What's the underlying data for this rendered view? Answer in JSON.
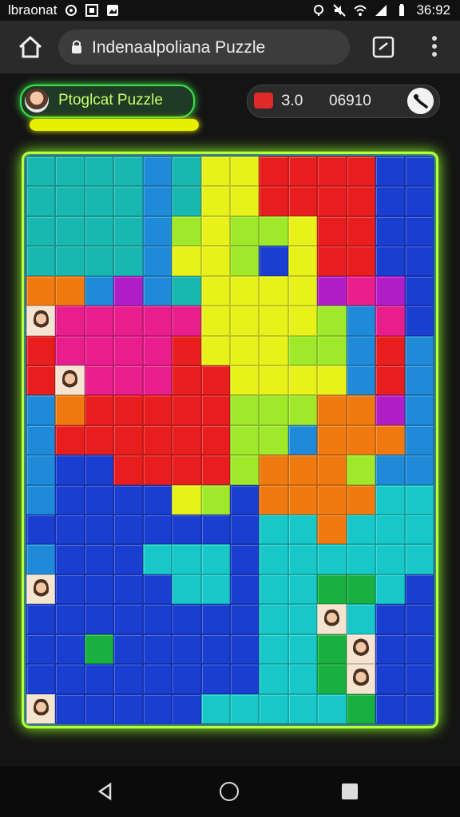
{
  "status_bar": {
    "carrier": "lbraonat",
    "time": "36:92",
    "icons_left": [
      "circle-icon",
      "photo-icon",
      "image-icon"
    ],
    "icons_right": [
      "location-icon",
      "mute-icon",
      "wifi-icon",
      "signal-icon",
      "battery-icon"
    ]
  },
  "browser": {
    "url_title": "Indenaalpoliana Puzzle",
    "icons": [
      "home-icon",
      "lock-icon",
      "tab-switch-icon",
      "more-vert-icon"
    ]
  },
  "game": {
    "player_name": "Ptoglcat Puzzle",
    "progress": 1.0,
    "score_a": "З.0",
    "score_b": "06910",
    "accent_color": "#b6ff3c"
  },
  "board": {
    "columns": 14,
    "rows": 19,
    "palette": {
      "T": "#18b8b0",
      "Y": "#e8f21a",
      "L": "#9fe82a",
      "R": "#e81e1e",
      "M": "#e81e8c",
      "P": "#b01ec8",
      "O": "#f07a10",
      "B": "#1a3ed0",
      "S": "#1e8ad8",
      "C": "#18c8c8",
      "G": "#18b040",
      "F": "face"
    },
    "grid": [
      "TTTTSTYYRRRRBB",
      "TTTTSTYYRRRRBB",
      "TTTTSLYLLYRRBB",
      "TTTTSYYLBYRRBB",
      "OOSPSTYYYYPMPB",
      "FMMMMMYYYYLSMB",
      "RMMMMRYYYLLSRS",
      "RFMMMRRYYYYSRS",
      "SORRRRRLLLOOPS",
      "SRRRRRRLLSOOOS",
      "SBBRRRRLOOOLSS",
      "SBBBBYLBOOOOCC",
      "BBBBBBBBCCOCCC",
      "SBBBCCCBCCCCCC",
      "FBBBBCCBCCGGCB",
      "BBBBBBBBCCFCBB",
      "BBGBBBBBCCGFBB",
      "BBBBBBBBCCGFBB",
      "FBBBBBCCCCCGBB"
    ]
  },
  "nav_bar": {
    "icons": [
      "back-icon",
      "home-circle-icon",
      "recents-icon"
    ]
  }
}
